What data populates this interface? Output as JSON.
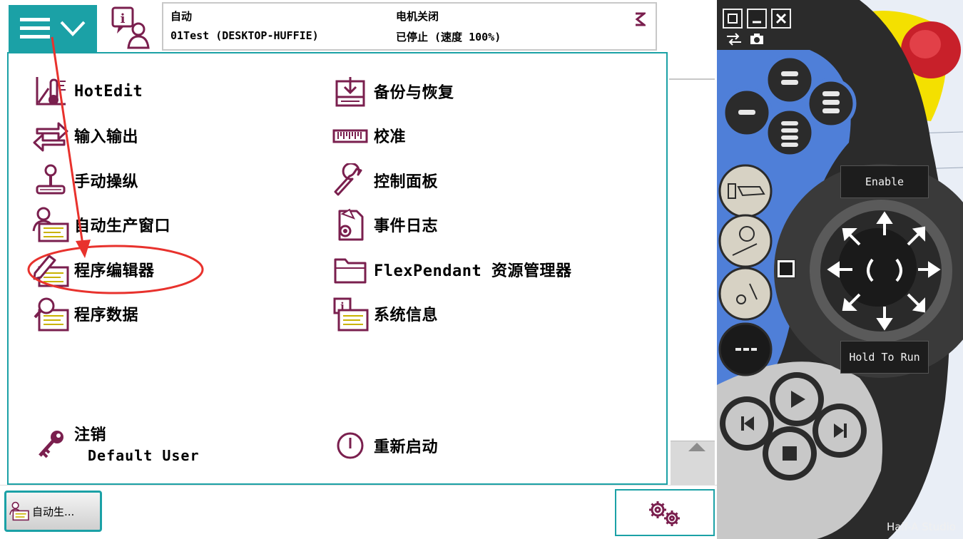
{
  "status_bar": {
    "mode": "自动",
    "system": "01Test (DESKTOP-HUFFIE)",
    "motor": "电机关闭",
    "state": "已停止 (速度 100%)"
  },
  "menu": {
    "left": [
      {
        "label": "HotEdit",
        "icon": "hotedit-icon"
      },
      {
        "label": "输入输出",
        "icon": "io-arrows-icon"
      },
      {
        "label": "手动操纵",
        "icon": "joystick-icon"
      },
      {
        "label": "自动生产窗口",
        "icon": "production-window-icon"
      },
      {
        "label": "程序编辑器",
        "icon": "program-editor-icon"
      },
      {
        "label": "程序数据",
        "icon": "program-data-icon"
      }
    ],
    "right": [
      {
        "label": "备份与恢复",
        "icon": "backup-icon"
      },
      {
        "label": "校准",
        "icon": "calibration-ruler-icon"
      },
      {
        "label": "控制面板",
        "icon": "wrench-icon"
      },
      {
        "label": "事件日志",
        "icon": "event-log-icon"
      },
      {
        "label": "FlexPendant 资源管理器",
        "icon": "folder-icon"
      },
      {
        "label": "系统信息",
        "icon": "system-info-icon"
      }
    ],
    "logoff": {
      "label": "注销",
      "user": "Default User",
      "icon": "key-icon"
    },
    "restart": {
      "label": "重新启动",
      "icon": "power-icon"
    }
  },
  "taskbar": {
    "task_label": "自动生...",
    "quickset_icon": "gears-icon"
  },
  "device": {
    "enable_label": "Enable",
    "hold_label": "Hold To Run",
    "watermark": "Half-A Studio"
  },
  "colors": {
    "accent": "#1ba1a6",
    "icon": "#7a1f4e",
    "annotation": "#e8322d",
    "device_dark": "#2b2b2b",
    "device_blue": "#4f7fd8",
    "emergency_red": "#c8202a",
    "emergency_yellow": "#f4e000"
  }
}
